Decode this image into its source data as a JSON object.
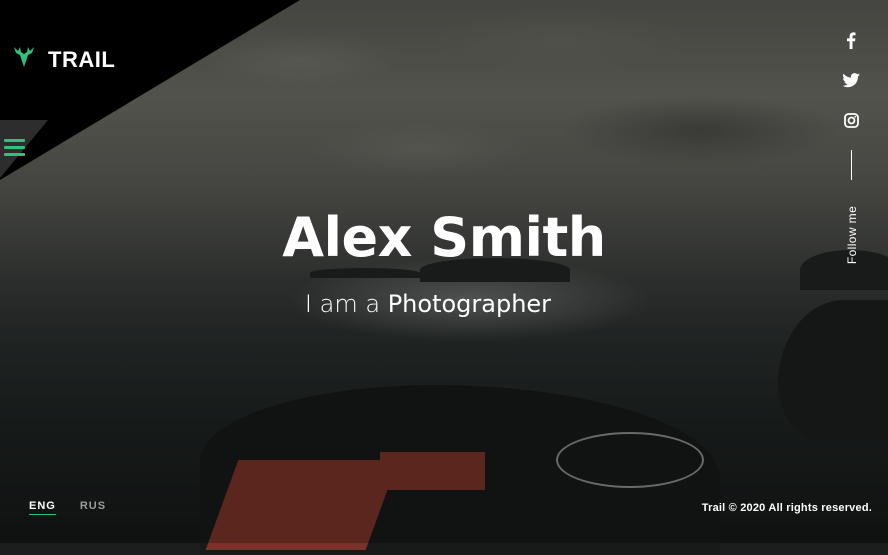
{
  "brand": {
    "name": "TRAIL",
    "icon": "deer-icon",
    "accent": "#2ec27e"
  },
  "nav": {
    "menu_icon": "hamburger-icon"
  },
  "hero": {
    "name": "Alex Smith",
    "tagline_prefix": "I am a",
    "tagline_role": "Photographer"
  },
  "social": {
    "links": [
      {
        "icon": "facebook-icon"
      },
      {
        "icon": "twitter-icon"
      },
      {
        "icon": "instagram-icon"
      }
    ],
    "follow_label": "Follow me"
  },
  "languages": {
    "active": "ENG",
    "other": "RUS"
  },
  "footer": {
    "copyright": "Trail © 2020 All rights reserved."
  }
}
